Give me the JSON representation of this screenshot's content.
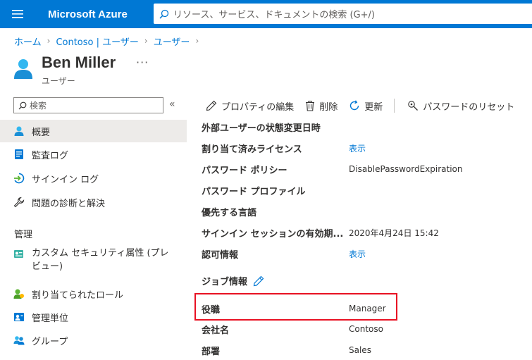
{
  "topbar": {
    "brand": "Microsoft Azure",
    "search_placeholder": "リソース、サービス、ドキュメントの検索 (G+/)"
  },
  "breadcrumb": [
    "ホーム",
    "Contoso | ユーザー",
    "ユーザー"
  ],
  "header": {
    "title": "Ben Miller",
    "subtitle": "ユーザー",
    "more": "···"
  },
  "sidebar": {
    "search_placeholder": "検索",
    "collapse": "«",
    "items": [
      {
        "label": "概要",
        "icon": "user-icon",
        "active": true
      },
      {
        "label": "監査ログ",
        "icon": "audit-log-icon"
      },
      {
        "label": "サインイン ログ",
        "icon": "sign-in-icon"
      },
      {
        "label": "問題の診断と解決",
        "icon": "wrench-icon"
      }
    ],
    "section_label": "管理",
    "manage_items": [
      {
        "label": "カスタム セキュリティ属性 (プレビュー)",
        "line1": "カスタム セキュリティ属性 (プレ",
        "line2": "ビュー)",
        "icon": "custom-attributes-icon"
      },
      {
        "label": "割り当てられたロール",
        "icon": "assigned-roles-icon"
      },
      {
        "label": "管理単位",
        "icon": "admin-units-icon"
      },
      {
        "label": "グループ",
        "icon": "groups-icon"
      }
    ]
  },
  "toolbar": {
    "edit": "プロパティの編集",
    "delete": "削除",
    "refresh": "更新",
    "reset_password": "パスワードのリセット"
  },
  "properties": [
    {
      "label": "外部ユーザーの状態変更日時",
      "value": ""
    },
    {
      "label": "割り当て済みライセンス",
      "value": "表示",
      "link": true
    },
    {
      "label": "パスワード ポリシー",
      "value": "DisablePasswordExpiration"
    },
    {
      "label": "パスワード プロファイル",
      "value": ""
    },
    {
      "label": "優先する言語",
      "value": ""
    },
    {
      "label": "サインイン セッションの有効期...",
      "value": "2020年4月24日 15:42"
    },
    {
      "label": "認可情報",
      "value": "表示",
      "link": true
    }
  ],
  "job_section": {
    "title": "ジョブ情報",
    "fields": [
      {
        "label": "役職",
        "value": "Manager"
      },
      {
        "label": "会社名",
        "value": "Contoso"
      },
      {
        "label": "部署",
        "value": "Sales"
      }
    ]
  },
  "colors": {
    "azure_blue": "#0078d4",
    "highlight_red": "#e81123",
    "active_bg": "#edebe9"
  }
}
